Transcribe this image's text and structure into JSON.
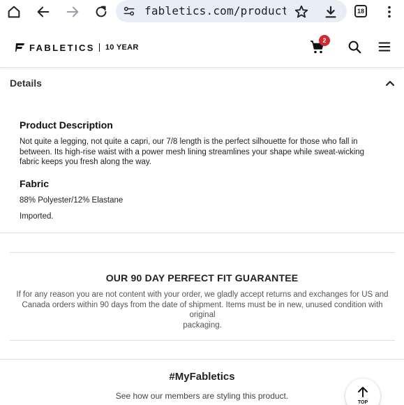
{
  "browser": {
    "url": "fabletics.com/products/HIGH-",
    "tab_count": "18",
    "icons": [
      "home-icon",
      "back-icon",
      "forward-icon",
      "reload-icon",
      "site-settings-icon",
      "star-icon",
      "download-icon",
      "tab-switcher-icon",
      "more-menu-icon"
    ]
  },
  "header": {
    "logo_word": "FABLETICS",
    "logo_year": "10 YEAR",
    "cart_count": "2",
    "colors": {
      "badge": "#d3282f"
    }
  },
  "details": {
    "title": "Details",
    "product_description_heading": "Product Description",
    "product_description_lines": [
      "Not quite a legging, not quite a capri, our 7/8 length is the perfect silhouette for those who fall in",
      "between. Its high-rise waist with a power mesh lining streamlines your shape while sweat-wicking",
      "fabric keeps you fresh along the way."
    ],
    "fabric_heading": "Fabric",
    "fabric_content": "88% Polyester/12% Elastane",
    "origin": "Imported."
  },
  "guarantee": {
    "title": "OUR 90 DAY PERFECT FIT GUARANTEE",
    "lines": [
      "If for any reason you are not content with your order, we gladly accept returns and exchanges for US and",
      "Canada orders within 90 days from the date of shipment. Items must be in new, unused condition with original",
      "packaging."
    ]
  },
  "community": {
    "title": "#MyFabletics",
    "subtitle": "See how our members are styling this product."
  },
  "back_to_top": {
    "label": "TOP"
  }
}
